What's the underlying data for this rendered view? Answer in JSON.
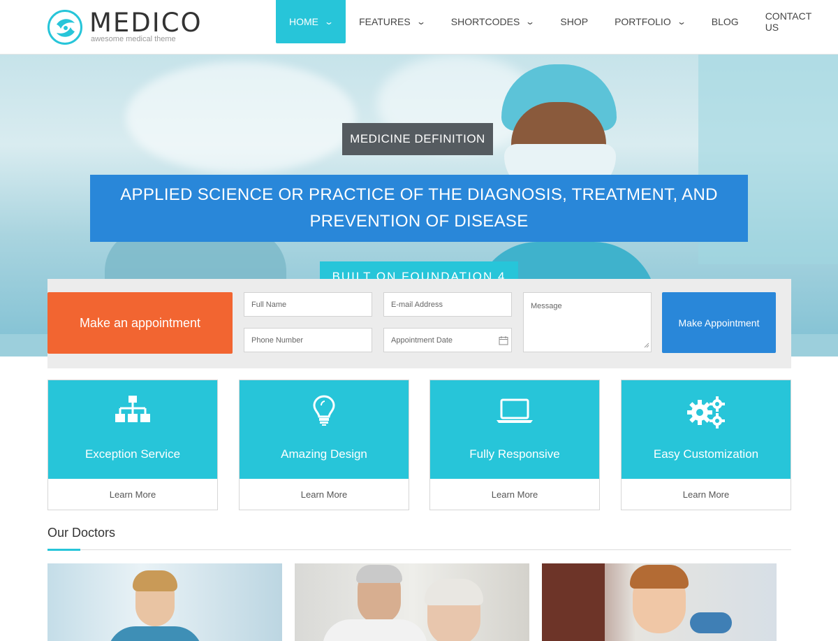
{
  "brand": {
    "name": "MEDICO",
    "tagline": "awesome medical theme",
    "accent": "#27c5d9",
    "blue": "#2987d9",
    "orange": "#f26531"
  },
  "nav": {
    "items": [
      {
        "label": "HOME",
        "dropdown": true,
        "active": true
      },
      {
        "label": "FEATURES",
        "dropdown": true
      },
      {
        "label": "SHORTCODES",
        "dropdown": true
      },
      {
        "label": "SHOP",
        "dropdown": false
      },
      {
        "label": "PORTFOLIO",
        "dropdown": true
      },
      {
        "label": "BLOG",
        "dropdown": false
      },
      {
        "label": "CONTACT US",
        "dropdown": false
      }
    ]
  },
  "hero": {
    "tag": "MEDICINE DEFINITION",
    "banner_line1": "APPLIED SCIENCE OR PRACTICE OF THE DIAGNOSIS, TREATMENT, AND",
    "banner_line2": "PREVENTION OF DISEASE",
    "pill": "BUILT ON FOUNDATION 4"
  },
  "appointment": {
    "cta": "Make an appointment",
    "full_name": "Full Name",
    "email": "E-mail Address",
    "phone": "Phone Number",
    "date": "Appointment Date",
    "message": "Message",
    "submit": "Make Appointment"
  },
  "features": [
    {
      "title": "Exception Service",
      "link": "Learn More",
      "icon": "sitemap-icon"
    },
    {
      "title": "Amazing Design",
      "link": "Learn More",
      "icon": "lightbulb-icon"
    },
    {
      "title": "Fully Responsive",
      "link": "Learn More",
      "icon": "laptop-icon"
    },
    {
      "title": "Easy Customization",
      "link": "Learn More",
      "icon": "gears-icon"
    }
  ],
  "doctors": {
    "title": "Our Doctors"
  }
}
